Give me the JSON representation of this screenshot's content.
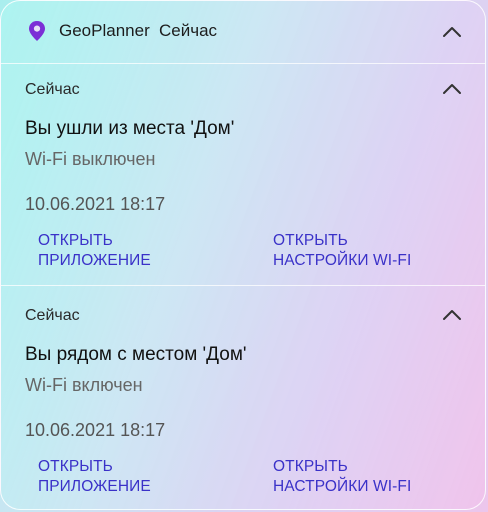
{
  "header": {
    "app_name": "GeoPlanner",
    "time": "Сейчас",
    "icon": "location-pin-icon",
    "accent": "#7b2fd6"
  },
  "notifications": [
    {
      "time": "Сейчас",
      "title": "Вы ушли из места 'Дом'",
      "subtitle": "Wi-Fi выключен",
      "date": "10.06.2021 18:17",
      "actions": [
        {
          "line1": "ОТКРЫТЬ",
          "line2": "ПРИЛОЖЕНИЕ"
        },
        {
          "line1": "ОТКРЫТЬ",
          "line2": "НАСТРОЙКИ WI-FI"
        }
      ]
    },
    {
      "time": "Сейчас",
      "title": "Вы рядом с местом 'Дом'",
      "subtitle": "Wi-Fi включен",
      "date": "10.06.2021 18:17",
      "actions": [
        {
          "line1": "ОТКРЫТЬ",
          "line2": "ПРИЛОЖЕНИЕ"
        },
        {
          "line1": "ОТКРЫТЬ",
          "line2": "НАСТРОЙКИ WI-FI"
        }
      ]
    }
  ],
  "colors": {
    "action_text": "#3a31c8"
  }
}
